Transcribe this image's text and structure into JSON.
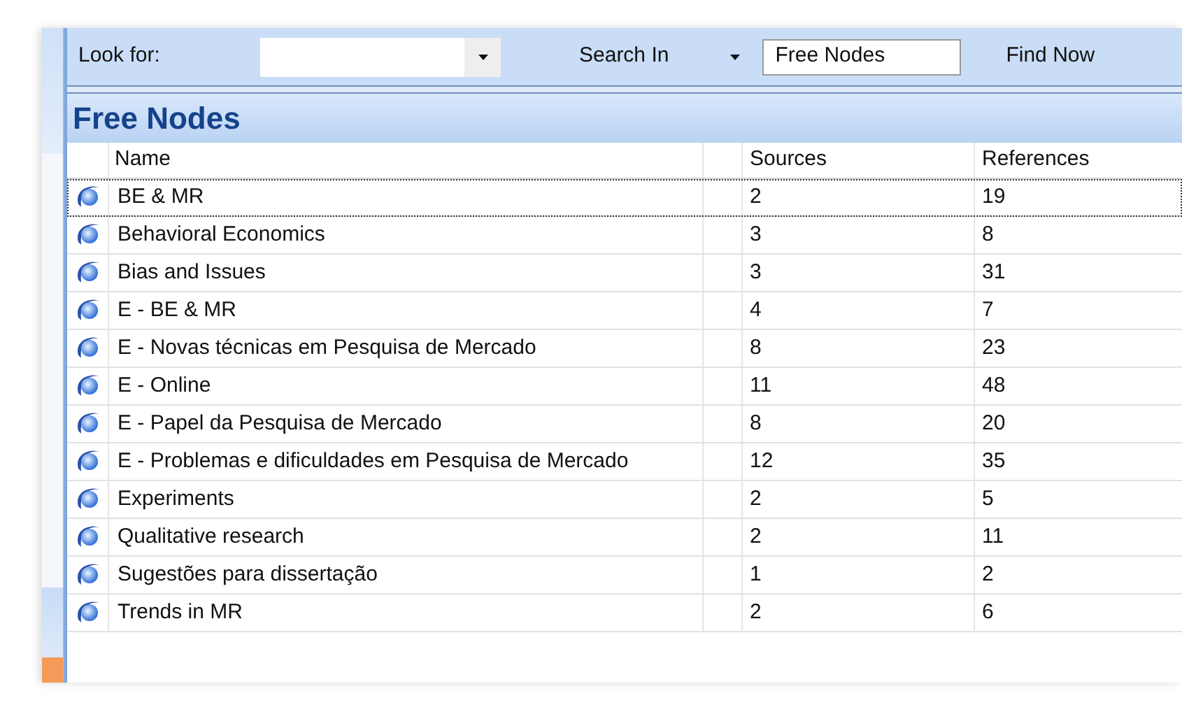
{
  "toolbar": {
    "look_for_label": "Look for:",
    "search_in_label": "Search In",
    "search_in_value": "Free Nodes",
    "find_now": "Find Now"
  },
  "panel_title": "Free Nodes",
  "table": {
    "columns": [
      "Name",
      "Sources",
      "References"
    ],
    "rows": [
      {
        "name": "BE & MR",
        "sources": "2",
        "references": "19",
        "selected": true
      },
      {
        "name": "Behavioral Economics",
        "sources": "3",
        "references": "8",
        "selected": false
      },
      {
        "name": "Bias and Issues",
        "sources": "3",
        "references": "31",
        "selected": false
      },
      {
        "name": "E - BE & MR",
        "sources": "4",
        "references": "7",
        "selected": false
      },
      {
        "name": "E - Novas técnicas em Pesquisa de Mercado",
        "sources": "8",
        "references": "23",
        "selected": false
      },
      {
        "name": "E - Online",
        "sources": "11",
        "references": "48",
        "selected": false
      },
      {
        "name": "E - Papel da Pesquisa de Mercado",
        "sources": "8",
        "references": "20",
        "selected": false
      },
      {
        "name": "E - Problemas e dificuldades em Pesquisa de Mercado",
        "sources": "12",
        "references": "35",
        "selected": false
      },
      {
        "name": "Experiments",
        "sources": "2",
        "references": "5",
        "selected": false
      },
      {
        "name": "Qualitative research",
        "sources": "2",
        "references": "11",
        "selected": false
      },
      {
        "name": "Sugestões para dissertação",
        "sources": "1",
        "references": "2",
        "selected": false
      },
      {
        "name": "Trends in MR",
        "sources": "2",
        "references": "6",
        "selected": false
      }
    ]
  }
}
